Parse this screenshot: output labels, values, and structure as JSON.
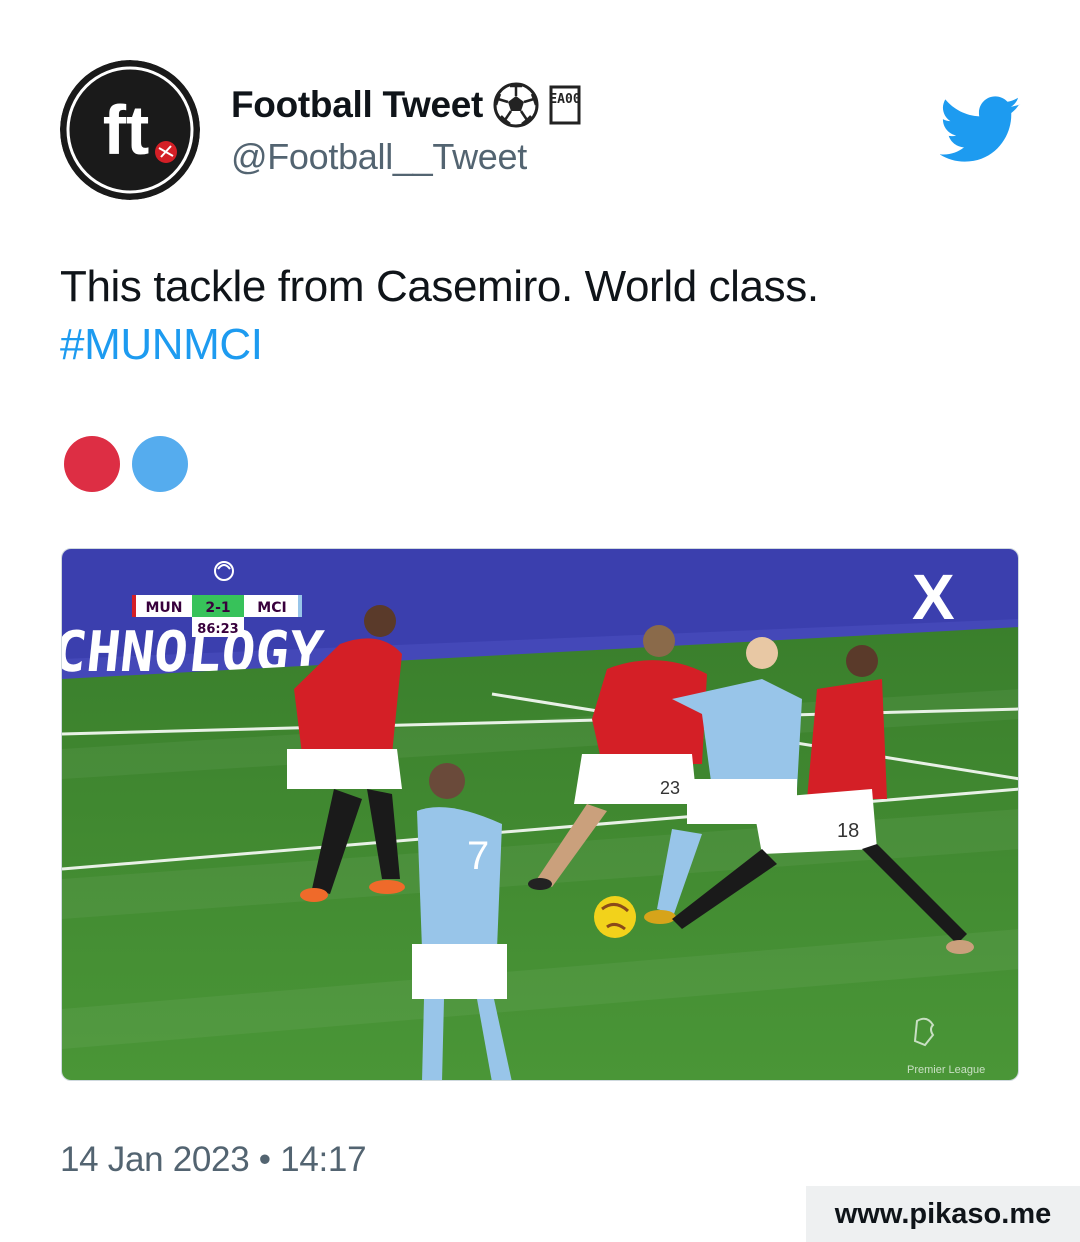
{
  "author": {
    "display_name": "Football Tweet",
    "handle": "@Football__Tweet",
    "avatar_text": "ft",
    "badges": [
      "soccer-ball-emoji",
      "ea-fc-logo"
    ],
    "badge_text": "EA00"
  },
  "tweet": {
    "text": "This tackle from Casemiro. World class.",
    "hashtag": "#MUNMCI",
    "emojis": [
      {
        "name": "red-circle",
        "color": "#dd2e44"
      },
      {
        "name": "blue-circle",
        "color": "#55acee"
      }
    ]
  },
  "media": {
    "type": "video-frame",
    "scoreboard": {
      "home": "MUN",
      "score": "2-1",
      "away": "MCI",
      "clock": "86:23"
    },
    "board_text": "CHNOLOGY",
    "player_numbers": [
      "7",
      "23",
      "18"
    ],
    "watermark_text": "Premier League"
  },
  "timestamp": "14 Jan 2023 • 14:17",
  "site_watermark": "www.pikaso.me",
  "colors": {
    "hashtag": "#1d9bf0",
    "twitter_blue": "#1d9bf0",
    "man_utd_red": "#d41f26",
    "man_city_blue": "#98c5e9",
    "pitch_green": "#3f8a32"
  }
}
